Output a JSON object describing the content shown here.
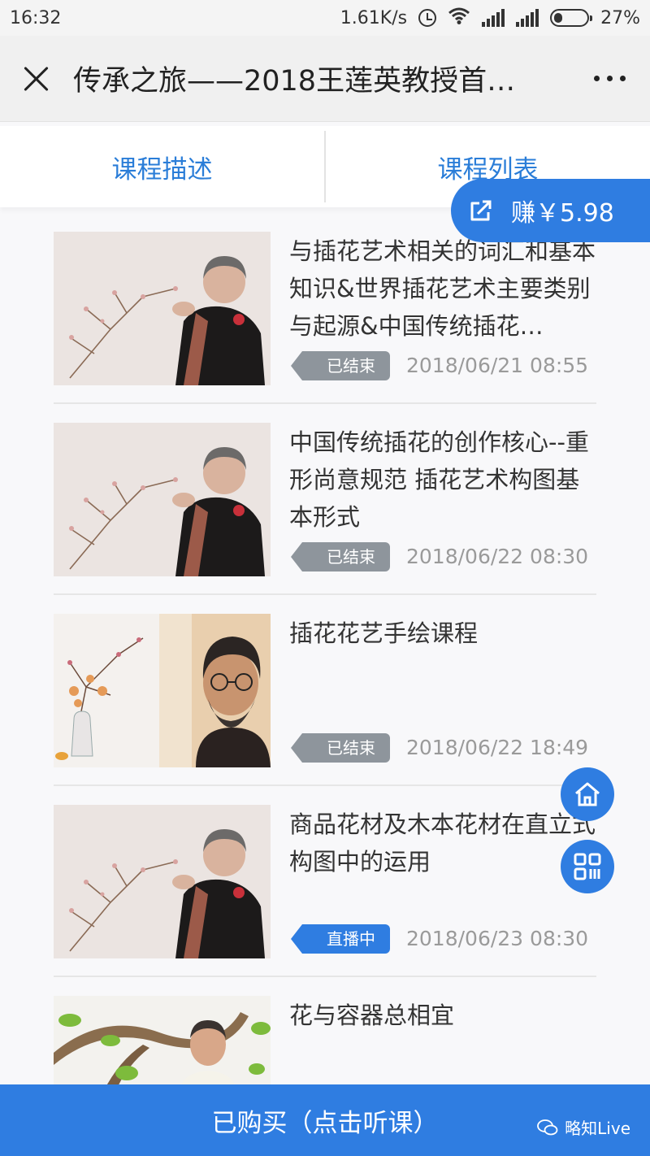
{
  "status_bar": {
    "time": "16:32",
    "speed": "1.61K/s",
    "battery": "27%"
  },
  "header": {
    "title": "传承之旅——2018王莲英教授首…"
  },
  "tabs": [
    {
      "label": "课程描述"
    },
    {
      "label": "课程列表"
    }
  ],
  "earn_badge": {
    "label": "赚￥5.98"
  },
  "lessons": [
    {
      "title": "与插花艺术相关的词汇和基本知识&世界插花艺术主要类别与起源&中国传统插花…",
      "status": "已结束",
      "time": "2018/06/21 08:55",
      "thumb": "teacher-woman"
    },
    {
      "title": "中国传统插花的创作核心--重形尚意规范 插花艺术构图基本形式",
      "status": "已结束",
      "time": "2018/06/22 08:30",
      "thumb": "teacher-woman"
    },
    {
      "title": "插花花艺手绘课程",
      "status": "已结束",
      "time": "2018/06/22 18:49",
      "thumb": "teacher-man-bearded"
    },
    {
      "title": "商品花材及木本花材在直立式构图中的运用",
      "status": "直播中",
      "time": "2018/06/23 08:30",
      "thumb": "teacher-woman"
    },
    {
      "title": "花与容器总相宜",
      "status": "",
      "time": "",
      "thumb": "teacher-man-branch"
    }
  ],
  "bottom_bar": {
    "label": "已购买（点击听课）"
  },
  "watermark": {
    "label": "略知Live"
  },
  "colors": {
    "accent": "#2f7de1",
    "tab_text": "#2a7dd8",
    "ended_tag": "#8e959c",
    "live_tag": "#2f7de1"
  }
}
